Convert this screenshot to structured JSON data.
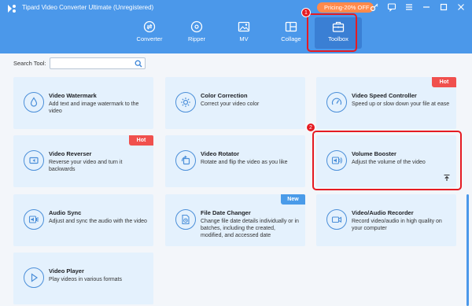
{
  "app": {
    "title": "Tipard Video Converter Ultimate (Unregistered)",
    "pricing_label": "Pricing-20% OFF"
  },
  "tabs": [
    {
      "label": "Converter",
      "icon": "converter-icon"
    },
    {
      "label": "Ripper",
      "icon": "disc-icon"
    },
    {
      "label": "MV",
      "icon": "mv-image-icon"
    },
    {
      "label": "Collage",
      "icon": "collage-icon"
    },
    {
      "label": "Toolbox",
      "icon": "toolbox-icon",
      "active": true
    }
  ],
  "annotations": {
    "step1": "1",
    "step2": "2"
  },
  "search": {
    "label": "Search Tool:",
    "placeholder": ""
  },
  "tools": [
    {
      "title": "Video Watermark",
      "desc": "Add text and image watermark to the video",
      "icon": "watermark-drop-icon"
    },
    {
      "title": "Color Correction",
      "desc": "Correct your video color",
      "icon": "sun-icon"
    },
    {
      "title": "Video Speed Controller",
      "desc": "Speed up or slow down your file at ease",
      "icon": "speedometer-icon",
      "tag": "Hot"
    },
    {
      "title": "Video Reverser",
      "desc": "Reverse your video and turn it backwards",
      "icon": "rewind-icon",
      "tag": "Hot"
    },
    {
      "title": "Video Rotator",
      "desc": "Rotate and flip the video as you like",
      "icon": "rotate-icon"
    },
    {
      "title": "Volume Booster",
      "desc": "Adjust the volume of the video",
      "icon": "volume-icon"
    },
    {
      "title": "Audio Sync",
      "desc": "Adjust and sync the audio with the video",
      "icon": "audio-sync-icon"
    },
    {
      "title": "File Date Changer",
      "desc": "Change file date details individually or in batches, including the created, modified, and accessed date",
      "icon": "file-date-icon",
      "tag": "New"
    },
    {
      "title": "Video/Audio Recorder",
      "desc": "Record video/audio in high quality on your computer",
      "icon": "camera-icon"
    },
    {
      "title": "Video Player",
      "desc": "Play videos in various formats",
      "icon": "play-icon"
    }
  ],
  "colors": {
    "header": "#4b98ea",
    "card": "#e4f1fd",
    "accent": "#4b8fd9",
    "highlight": "#e51b22",
    "hot": "#f0504d",
    "new": "#4a9be9",
    "pricing": "#ff8a4b"
  }
}
